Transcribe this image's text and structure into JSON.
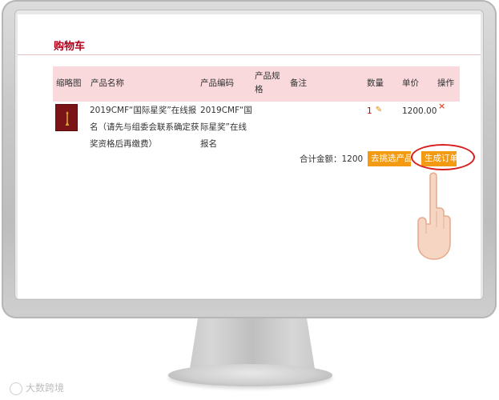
{
  "cart": {
    "title": "购物车",
    "headers": {
      "thumbnail": "缩略图",
      "name": "产品名称",
      "code": "产品编码",
      "spec": "产品规格",
      "note": "备注",
      "qty": "数量",
      "price": "单价",
      "action": "操作"
    },
    "items": [
      {
        "name_lines": [
          "2019CMF“国际星奖”在线报",
          "名（请先与组委会联系确定获",
          "奖资格后再缴费）"
        ],
        "code_lines": [
          "2019CMF“国",
          "际星奖”在线",
          "报名"
        ],
        "spec": "",
        "note": "",
        "qty": "1",
        "price": "1200.00",
        "delete_symbol": "×"
      }
    ],
    "total_label": "合计金额：1200",
    "browse_button": "去挑选产品",
    "order_button": "生成订单"
  },
  "watermark": "大数跨境",
  "colors": {
    "title": "#b0001b",
    "header_bg": "#f9d9dc",
    "button_bg": "#f29b12",
    "highlight": "#d81e1e"
  }
}
